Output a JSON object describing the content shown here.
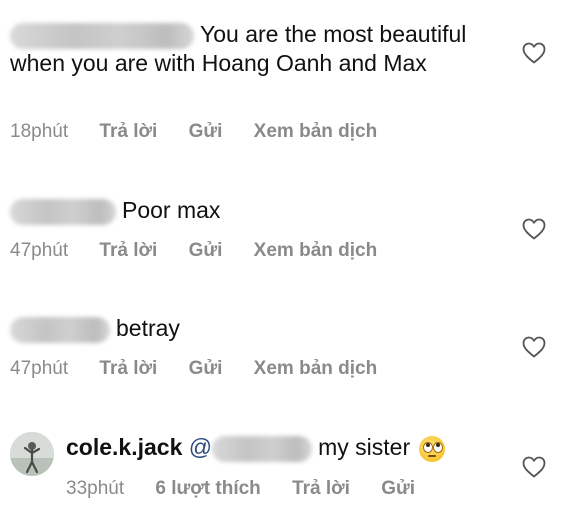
{
  "comments": [
    {
      "text": "You are the most beautiful when you are with Hoang Oanh and Max",
      "time": "18phút",
      "reply": "Trả lời",
      "send": "Gửi",
      "translate": "Xem bản dịch"
    },
    {
      "text": "Poor max",
      "time": "47phút",
      "reply": "Trả lời",
      "send": "Gửi",
      "translate": "Xem bản dịch"
    },
    {
      "text": "betray",
      "time": "47phút",
      "reply": "Trả lời",
      "send": "Gửi",
      "translate": "Xem bản dịch"
    },
    {
      "username": "cole.k.jack",
      "mention_prefix": "@",
      "text": "my sister",
      "time": "33phút",
      "likes": "6 lượt thích",
      "reply": "Trả lời",
      "send": "Gửi"
    }
  ],
  "icons": {
    "like": "heart-outline-icon",
    "emoji": "face-with-rolling-eyes-emoji"
  },
  "colors": {
    "meta": "#8a8a8a",
    "text": "#111111",
    "mention": "#2c4b7c"
  }
}
